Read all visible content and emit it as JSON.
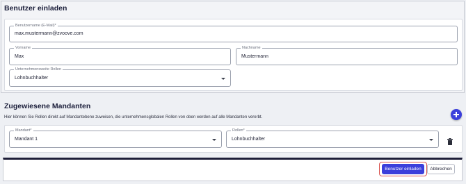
{
  "invite_section": {
    "title": "Benutzer einladen",
    "username": {
      "label": "Benutzername (E-Mail)*",
      "value": "max.mustermann@zvoove.com"
    },
    "first_name": {
      "label": "Vorname",
      "value": "Max"
    },
    "last_name": {
      "label": "Nachname",
      "value": "Mustermann"
    },
    "company_roles": {
      "label": "Unternehmensweite Rollen",
      "value": "Lohnbuchhalter"
    }
  },
  "clients_section": {
    "title": "Zugewiesene Mandanten",
    "hint": "Hier können Sie Rollen direkt auf Mandantebene zuweisen, die unternehmensglobalen Rollen von oben werden auf alle Mandanten vererbt.",
    "client": {
      "label": "Mandant*",
      "value": "Mandant 1"
    },
    "roles": {
      "label": "Rollen*",
      "value": "Lohnbuchhalter"
    }
  },
  "footer": {
    "invite_button": "Benutzer einladen",
    "cancel_button": "Abbrechen"
  },
  "colors": {
    "primary": "#3b3fdb",
    "highlight": "#d9534f",
    "footer_bar": "#1d1e38"
  },
  "icons": {
    "add": "plus-icon",
    "delete": "trash-icon",
    "dropdown": "chevron-down-icon"
  }
}
